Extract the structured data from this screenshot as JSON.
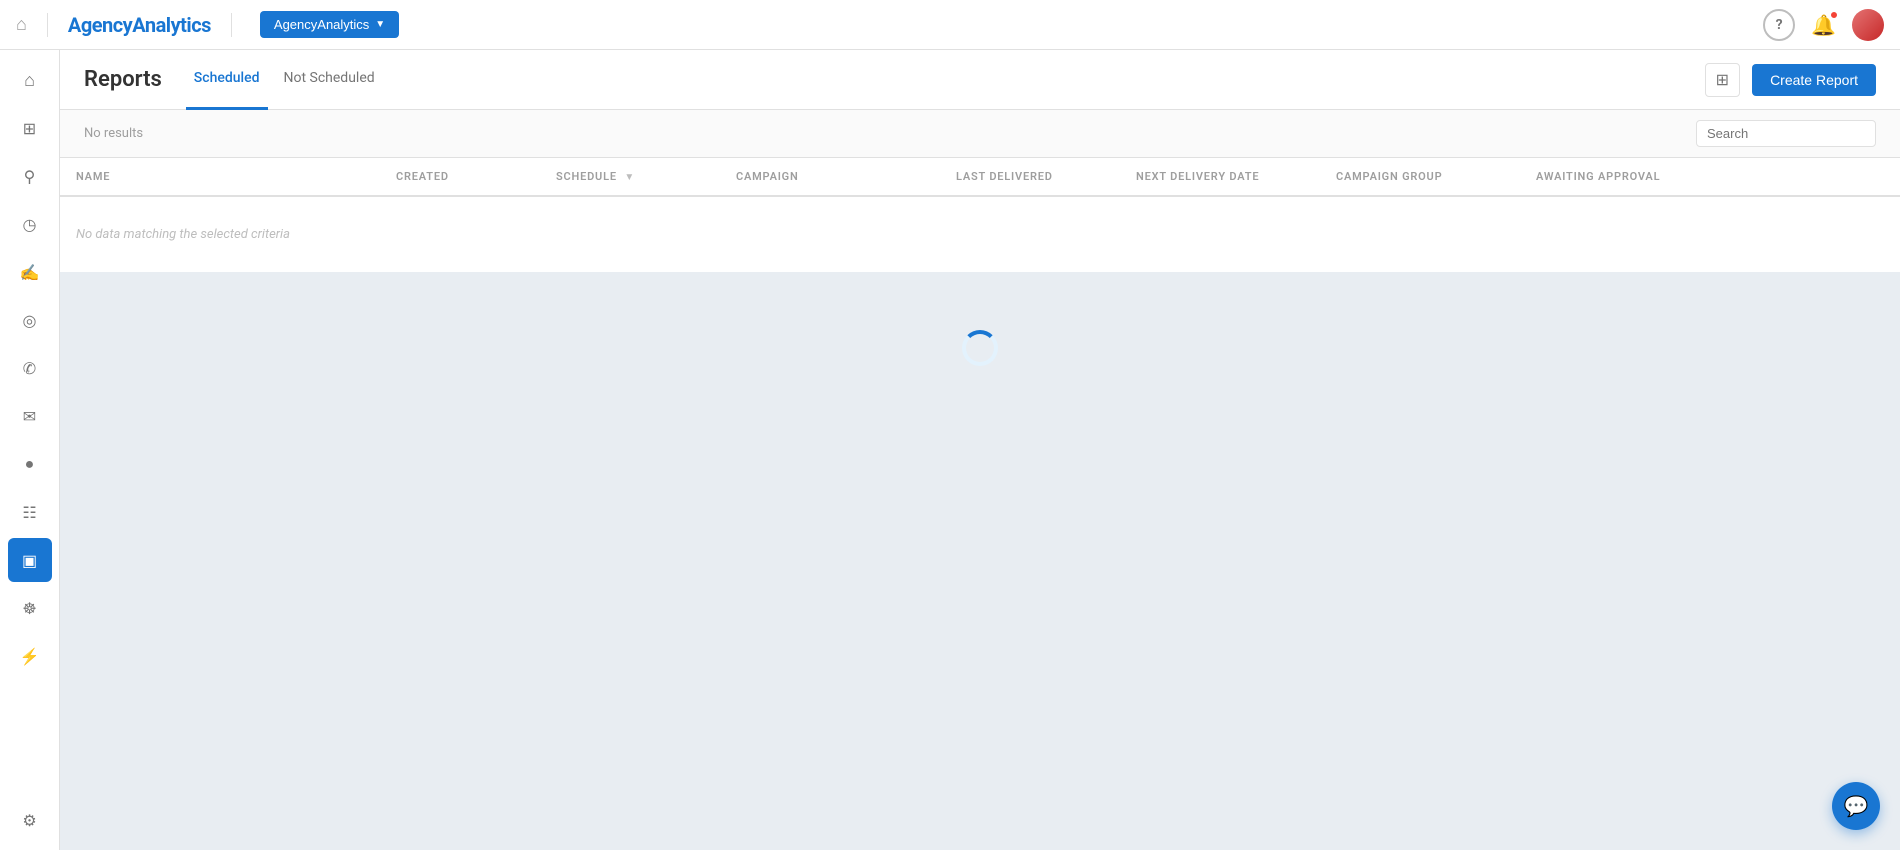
{
  "topnav": {
    "logo_agency": "Agency",
    "logo_analytics": "Analytics",
    "agency_button": "AgencyAnalytics",
    "help_label": "?",
    "help_aria": "Help"
  },
  "page": {
    "title": "Reports",
    "create_button": "Create Report",
    "tabs": [
      {
        "id": "scheduled",
        "label": "Scheduled",
        "active": true
      },
      {
        "id": "not-scheduled",
        "label": "Not Scheduled",
        "active": false
      }
    ]
  },
  "table": {
    "no_results": "No results",
    "no_data_message": "No data matching the selected criteria",
    "search_placeholder": "Search",
    "columns": [
      {
        "id": "name",
        "label": "NAME",
        "sortable": false
      },
      {
        "id": "created",
        "label": "CREATED",
        "sortable": false
      },
      {
        "id": "schedule",
        "label": "SCHEDULE",
        "sortable": true
      },
      {
        "id": "campaign",
        "label": "CAMPAIGN",
        "sortable": false
      },
      {
        "id": "last-delivered",
        "label": "LAST DELIVERED",
        "sortable": false
      },
      {
        "id": "next-delivery",
        "label": "NEXT DELIVERY DATE",
        "sortable": false
      },
      {
        "id": "campaign-group",
        "label": "CAMPAIGN GROUP",
        "sortable": false
      },
      {
        "id": "awaiting",
        "label": "AWAITING APPROVAL",
        "sortable": false
      }
    ]
  },
  "sidebar": {
    "items": [
      {
        "id": "home",
        "icon": "⌂",
        "label": "Home",
        "active": false
      },
      {
        "id": "grid",
        "icon": "⊞",
        "label": "Dashboard",
        "active": false
      },
      {
        "id": "search",
        "icon": "🔍",
        "label": "Search",
        "active": false
      },
      {
        "id": "clock",
        "icon": "◷",
        "label": "Activity",
        "active": false
      },
      {
        "id": "chat",
        "icon": "💬",
        "label": "Chat",
        "active": false
      },
      {
        "id": "eye",
        "icon": "◉",
        "label": "Monitor",
        "active": false
      },
      {
        "id": "phone",
        "icon": "📞",
        "label": "Calls",
        "active": false
      },
      {
        "id": "mail",
        "icon": "✉",
        "label": "Email",
        "active": false
      },
      {
        "id": "pin",
        "icon": "📍",
        "label": "Location",
        "active": false
      },
      {
        "id": "cart",
        "icon": "🛒",
        "label": "Commerce",
        "active": false
      },
      {
        "id": "reports",
        "icon": "📄",
        "label": "Reports",
        "active": true
      },
      {
        "id": "users",
        "icon": "👥",
        "label": "Users",
        "active": false
      },
      {
        "id": "integrations",
        "icon": "⚡",
        "label": "Integrations",
        "active": false
      },
      {
        "id": "settings",
        "icon": "⚙",
        "label": "Settings",
        "active": false
      }
    ]
  },
  "colors": {
    "brand_blue": "#1976D2",
    "active_sidebar_bg": "#1976D2",
    "text_muted": "#9e9e9e",
    "border": "#e0e0e0"
  }
}
